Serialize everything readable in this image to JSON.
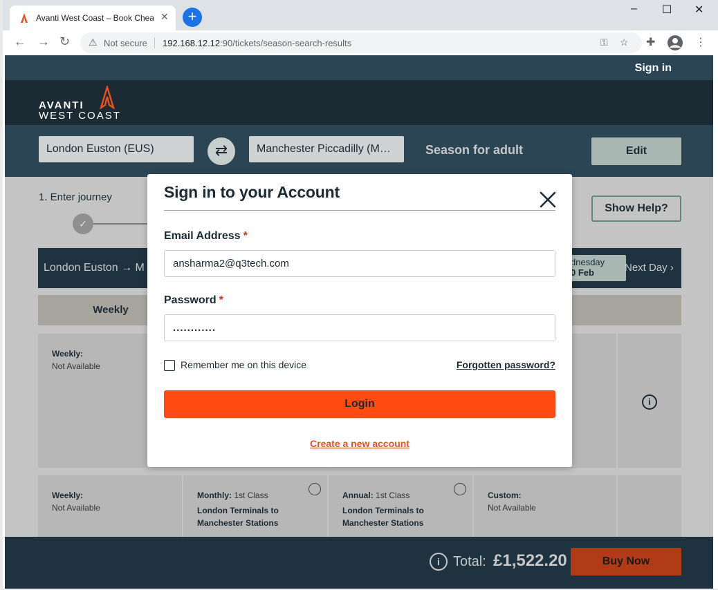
{
  "browser": {
    "tab_title": "Avanti West Coast – Book Cheap",
    "tab_close": "✕",
    "new_tab": "+",
    "security_label": "Not secure",
    "url_host": "192.168.12.12",
    "url_rest": ":90/tickets/season-search-results",
    "window_controls": [
      "–",
      "☐",
      "✕"
    ]
  },
  "site": {
    "signin_link": "Sign in",
    "logo_line1": "AVANTI",
    "logo_line2": "WEST COAST",
    "origin": "London Euston (EUS)",
    "destination": "Manchester Piccadilly (M…",
    "season_label": "Season for adult",
    "edit_button": "Edit",
    "step_label": "1. Enter journey",
    "show_help_button": "Show Help?",
    "journey_route": "London Euston → M",
    "day_line1": "dnesday",
    "day_line2": "0 Feb",
    "next_day": "Next Day ›",
    "tab_weekly": "Weekly",
    "cards_row1": [
      {
        "title": "Weekly:",
        "status": "Not Available"
      }
    ],
    "cards_row2": [
      {
        "title": "Weekly:",
        "status": "Not Available"
      },
      {
        "title": "Monthly:",
        "class": "1st Class",
        "route": "London Terminals to Manchester Stations"
      },
      {
        "title": "Annual:",
        "class": "1st Class",
        "route": "London Terminals to Manchester Stations"
      },
      {
        "title": "Custom:",
        "status": "Not Available"
      }
    ],
    "total_label": "Total:",
    "total_value": "£1,522.20",
    "buy_now_button": "Buy Now"
  },
  "modal": {
    "title": "Sign in to your Account",
    "email_label": "Email Address",
    "email_value": "ansharma2@q3tech.com",
    "password_label": "Password",
    "password_value": "............",
    "required_marker": "*",
    "remember_label": "Remember me on this device",
    "forgot_link": "Forgotten password?",
    "login_button": "Login",
    "create_account_link": "Create a new account"
  },
  "colors": {
    "brand_orange": "#ff4a12",
    "brand_navy": "#1b2a33",
    "teal_dark": "#2c4554"
  }
}
